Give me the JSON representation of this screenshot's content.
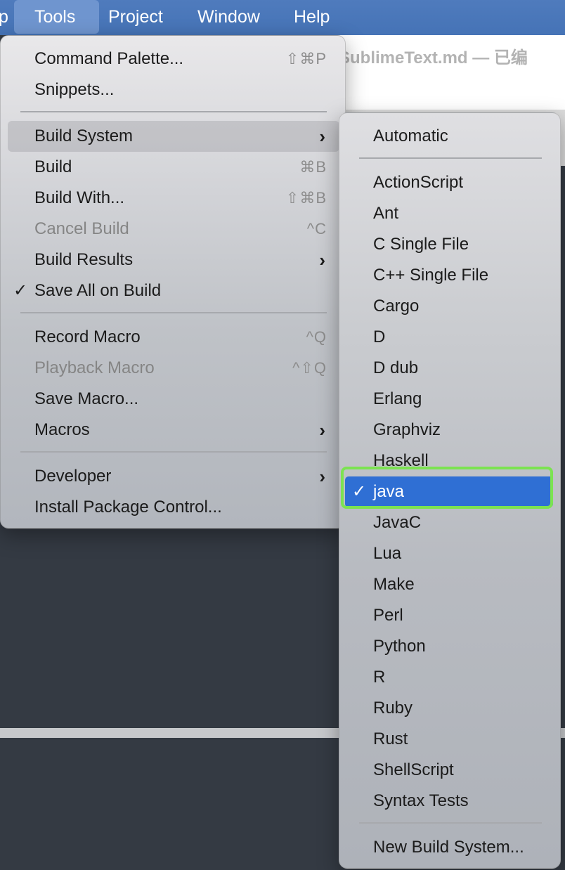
{
  "menubar": {
    "partial_left": "p",
    "items": [
      "Tools",
      "Project",
      "Window",
      "Help"
    ]
  },
  "background_window": {
    "title": "SublimeText.md — 已编"
  },
  "tools_menu": {
    "items": [
      {
        "label": "Command Palette...",
        "shortcut": "⇧⌘P"
      },
      {
        "label": "Snippets..."
      },
      {
        "label": "Build System",
        "submenu": "›"
      },
      {
        "label": "Build",
        "shortcut": "⌘B"
      },
      {
        "label": "Build With...",
        "shortcut": "⇧⌘B"
      },
      {
        "label": "Cancel Build",
        "shortcut": "^C"
      },
      {
        "label": "Build Results",
        "submenu": "›"
      },
      {
        "label": "Save All on Build",
        "check": "✓"
      },
      {
        "label": "Record Macro",
        "shortcut": "^Q"
      },
      {
        "label": "Playback Macro",
        "shortcut": "^⇧Q"
      },
      {
        "label": "Save Macro..."
      },
      {
        "label": "Macros",
        "submenu": "›"
      },
      {
        "label": "Developer",
        "submenu": "›"
      },
      {
        "label": "Install Package Control..."
      }
    ]
  },
  "build_system_menu": {
    "items": [
      "Automatic",
      "ActionScript",
      "Ant",
      "C Single File",
      "C++ Single File",
      "Cargo",
      "D",
      "D dub",
      "Erlang",
      "Graphviz",
      "Haskell",
      "java",
      "JavaC",
      "Lua",
      "Make",
      "Perl",
      "Python",
      "R",
      "Ruby",
      "Rust",
      "ShellScript",
      "Syntax Tests",
      "New Build System..."
    ],
    "selected_check": "✓"
  },
  "colors": {
    "menubar": "#4573b6",
    "selected": "#2f6fd4",
    "highlight_outline": "#7ce351"
  }
}
